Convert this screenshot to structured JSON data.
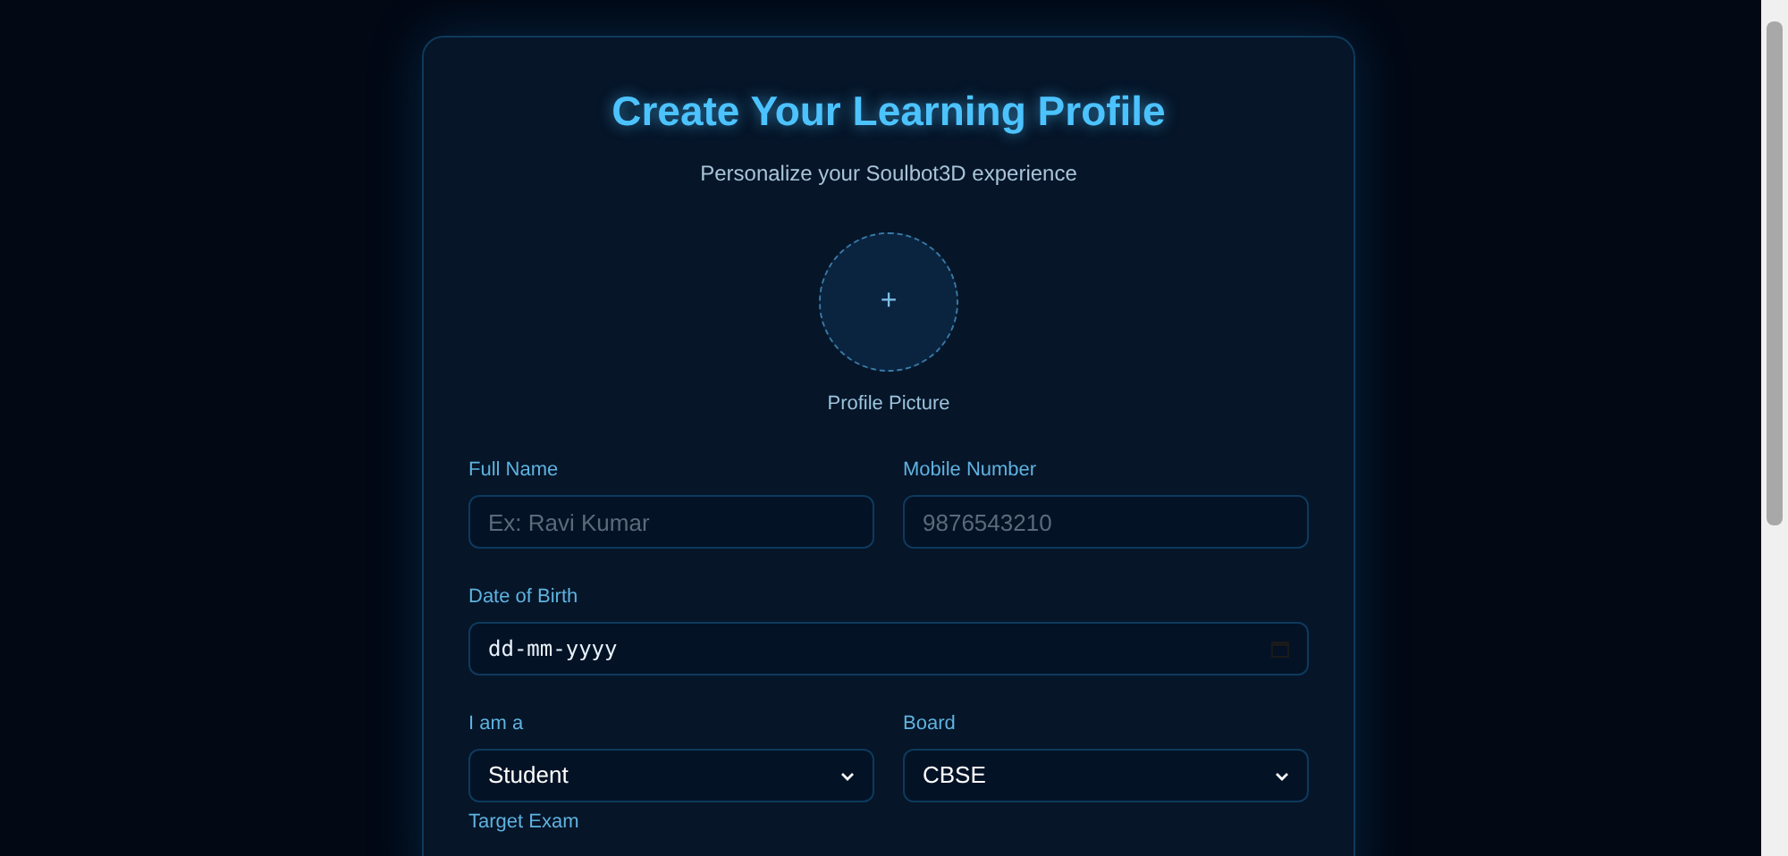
{
  "header": {
    "title": "Create Your Learning Profile",
    "subtitle": "Personalize your Soulbot3D experience"
  },
  "avatar": {
    "symbol": "+",
    "label": "Profile Picture"
  },
  "rows": [
    [
      {
        "kind": "text",
        "label": "Full Name",
        "placeholder": "Ex: Ravi Kumar"
      },
      {
        "kind": "text",
        "label": "Mobile Number",
        "placeholder": "9876543210"
      }
    ],
    [
      {
        "kind": "date",
        "label": "Date of Birth",
        "placeholder": "dd-mm-yyyy"
      }
    ],
    [
      {
        "kind": "select",
        "label": "I am a",
        "value": "Student"
      },
      {
        "kind": "select",
        "label": "Board",
        "value": "CBSE"
      }
    ],
    [
      {
        "kind": "label",
        "label": "Target Exam"
      }
    ]
  ]
}
